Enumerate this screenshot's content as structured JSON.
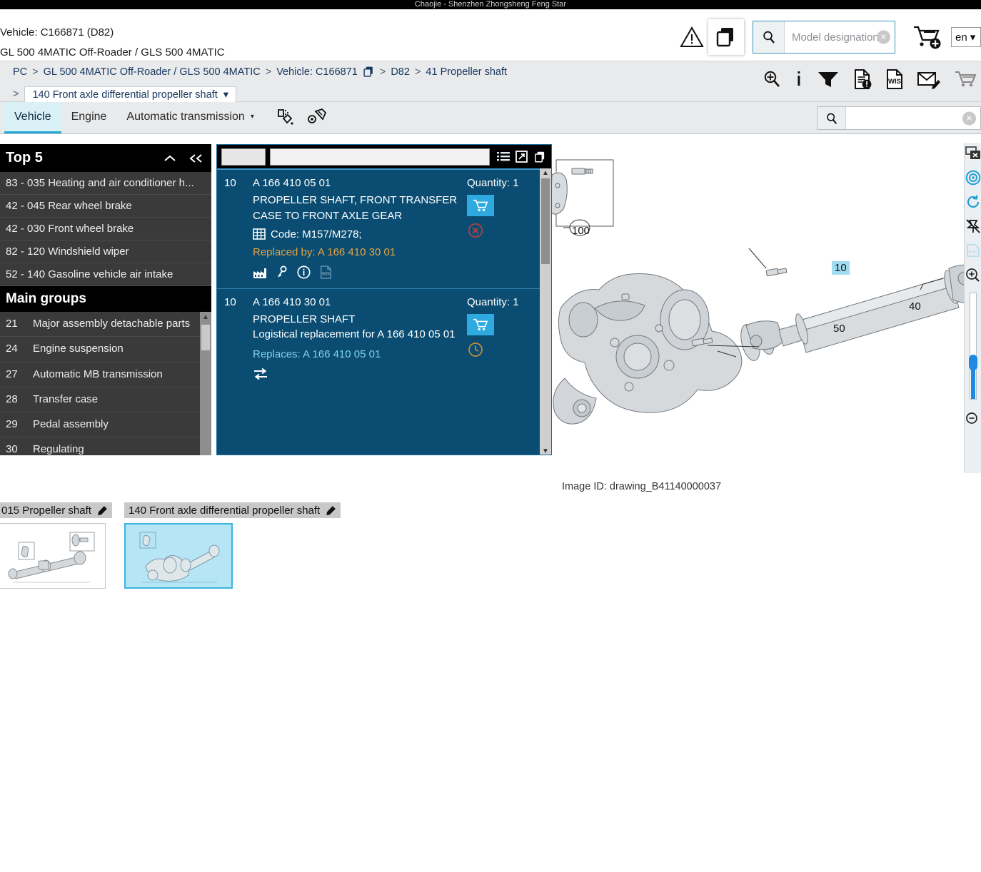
{
  "window": {
    "title": "Chaojie - Shenzhen Zhongsheng Feng Star"
  },
  "header": {
    "vehicle_line": "Vehicle: C166871 (D82)",
    "model_line": "GL 500 4MATIC Off-Roader / GLS 500 4MATIC",
    "warning_icon": "warning-triangle-icon",
    "copy_icon": "copy-icon",
    "search": {
      "placeholder": "Model designation",
      "value": "",
      "icon": "search-icon",
      "clear_icon": "clear-icon"
    },
    "cart_icon": "add-to-cart-icon",
    "language": {
      "value": "en",
      "caret": "▾"
    }
  },
  "breadcrumb": {
    "items": [
      "PC",
      "GL 500 4MATIC Off-Roader / GLS 500 4MATIC",
      "Vehicle: C166871",
      "D82",
      "41 Propeller shaft"
    ],
    "vehicle_copy_icon": "copy-icon",
    "separator": ">",
    "current": {
      "label": "140 Front axle differential propeller shaft",
      "caret": "▾"
    }
  },
  "toolbar_icons": [
    {
      "name": "zoom-in-icon",
      "label": "Zoom"
    },
    {
      "name": "info-icon",
      "label": "Info"
    },
    {
      "name": "filter-icon",
      "label": "Filter"
    },
    {
      "name": "document-alert-icon",
      "label": "Document notes"
    },
    {
      "name": "wis-document-icon",
      "label": "WIS"
    },
    {
      "name": "mail-edit-icon",
      "label": "Mail"
    },
    {
      "name": "cart-icon",
      "label": "Cart"
    }
  ],
  "tabs": {
    "items": [
      {
        "label": "Vehicle",
        "active": true,
        "caret": ""
      },
      {
        "label": "Engine",
        "active": false,
        "caret": ""
      },
      {
        "label": "Automatic transmission",
        "active": false,
        "caret": "▾"
      }
    ],
    "tools": [
      {
        "name": "paint-code-icon"
      },
      {
        "name": "upholstery-code-icon"
      }
    ],
    "search": {
      "value": "",
      "placeholder": "",
      "icon": "search-icon",
      "clear_icon": "clear-icon"
    }
  },
  "sidebar": {
    "top5": {
      "title": "Top 5",
      "collapse_icon": "chevron-up-icon",
      "hide_icon": "double-chevron-left-icon",
      "items": [
        "83 - 035 Heating and air conditioner h...",
        "42 - 045 Rear wheel brake",
        "42 - 030 Front wheel brake",
        "82 - 120 Windshield wiper",
        "52 - 140 Gasoline vehicle air intake"
      ]
    },
    "main_groups": {
      "title": "Main groups",
      "items": [
        {
          "num": "21",
          "label": "Major assembly detachable parts"
        },
        {
          "num": "24",
          "label": "Engine suspension"
        },
        {
          "num": "27",
          "label": "Automatic MB transmission"
        },
        {
          "num": "28",
          "label": "Transfer case"
        },
        {
          "num": "29",
          "label": "Pedal assembly"
        },
        {
          "num": "30",
          "label": "Regulating"
        }
      ]
    }
  },
  "parts_panel": {
    "header": {
      "list_icon": "list-view-icon",
      "expand_icon": "expand-icon",
      "copy_icon": "copy-icon"
    },
    "items": [
      {
        "position": "10",
        "part_number": "A 166 410 05 01",
        "description": "PROPELLER SHAFT, FRONT TRANSFER CASE TO FRONT AXLE GEAR",
        "code_label": "Code: M157/M278;",
        "code_icon": "table-icon",
        "replaced_by": "Replaced by: A 166 410 30 01",
        "quantity": "Quantity: 1",
        "cart_icon": "cart-icon",
        "status_icon": "not-available-icon",
        "action_icons": [
          "factory-icon",
          "key-icon",
          "info-circle-icon",
          "wis-document-icon"
        ]
      },
      {
        "position": "10",
        "part_number": "A 166 410 30 01",
        "description": "PROPELLER SHAFT",
        "note": "Logistical replacement for A 166 410 05 01",
        "replaces": "Replaces: A 166 410 05 01",
        "quantity": "Quantity: 1",
        "cart_icon": "cart-icon",
        "status_icon": "clock-icon",
        "action_icons": [
          "exchange-icon"
        ]
      }
    ]
  },
  "diagram": {
    "image_id": "Image ID: drawing_B41140000037",
    "callouts": [
      {
        "label": "100",
        "highlighted": false
      },
      {
        "label": "10",
        "highlighted": true
      },
      {
        "label": "40",
        "highlighted": false
      },
      {
        "label": "50",
        "highlighted": false
      }
    ]
  },
  "viewer_toolbar": [
    {
      "name": "close-window-icon"
    },
    {
      "name": "target-focus-icon"
    },
    {
      "name": "reset-rotate-icon"
    },
    {
      "name": "unpin-icon"
    },
    {
      "name": "svg-export-icon"
    },
    {
      "name": "zoom-in-icon"
    },
    {
      "name": "zoom-slider"
    },
    {
      "name": "zoom-out-icon"
    }
  ],
  "zoom_slider": {
    "value": 30
  },
  "thumbnails": [
    {
      "label": "015 Propeller shaft",
      "edit_icon": "edit-icon",
      "selected": false
    },
    {
      "label": "140 Front axle differential propeller shaft",
      "edit_icon": "edit-icon",
      "selected": true
    }
  ],
  "colors": {
    "accent": "#24a8d6",
    "panel_blue": "#0b4d72",
    "orange": "#e8a33d",
    "link_blue": "#7fd2f2",
    "sidebar_dark": "#3a3a3a"
  }
}
